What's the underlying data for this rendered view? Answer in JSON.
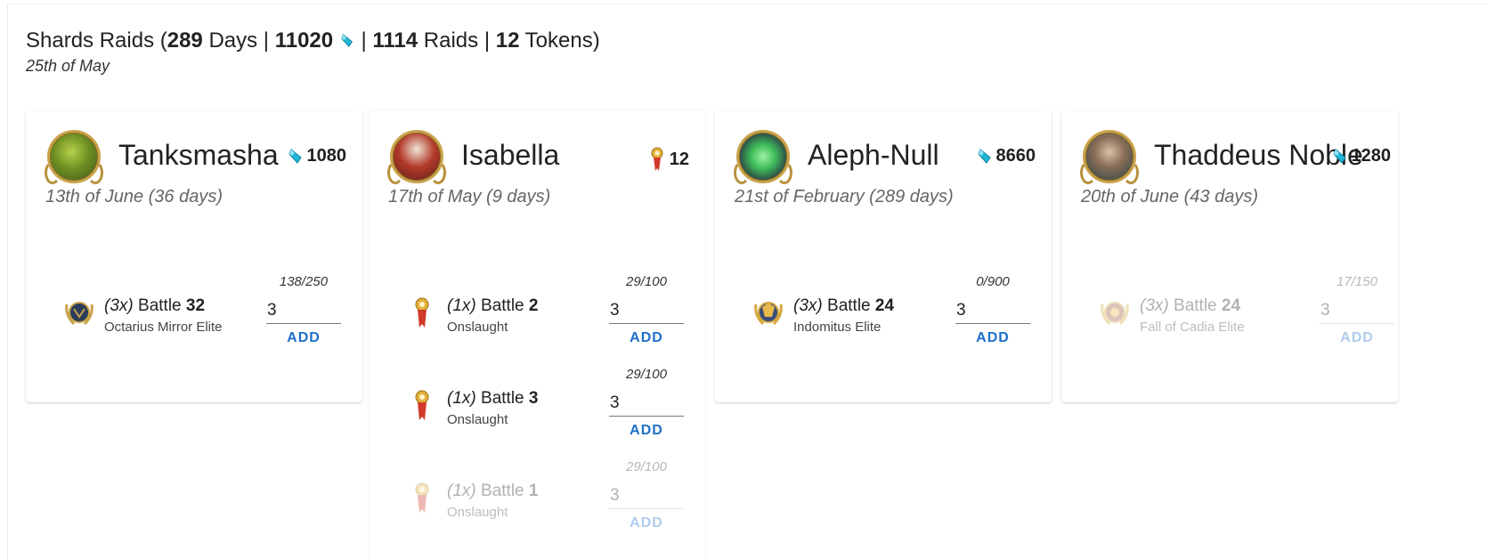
{
  "header": {
    "title_prefix": "Shards Raids (",
    "days_value": "289",
    "days_label": " Days | ",
    "shards_value": "11020",
    "sep1": " | ",
    "raids_value": "1114",
    "raids_label": " Raids | ",
    "tokens_value": "12",
    "tokens_label": " Tokens)",
    "date": "25th of May"
  },
  "colors": {
    "accent": "#1e6fc9",
    "shard": "#1fb7d6",
    "token": "#d13a2a"
  },
  "cards": [
    {
      "name": "Tanksmasha",
      "reward_icon": "shard-icon",
      "reward": "1080",
      "date": "13th of June (36 days)",
      "raids": [
        {
          "mult": "(3x)",
          "label": "Battle",
          "num": "32",
          "location": "Octarius Mirror Elite",
          "progress": "138/250",
          "qty": "3",
          "add": "ADD",
          "icon": "elite-laurel-icon"
        }
      ]
    },
    {
      "name": "Isabella",
      "reward_icon": "token-icon",
      "reward": "12",
      "date": "17th of May (9 days)",
      "raids": [
        {
          "mult": "(1x)",
          "label": "Battle",
          "num": "2",
          "location": "Onslaught",
          "progress": "29/100",
          "qty": "3",
          "add": "ADD",
          "icon": "onslaught-token-icon"
        },
        {
          "mult": "(1x)",
          "label": "Battle",
          "num": "3",
          "location": "Onslaught",
          "progress": "29/100",
          "qty": "3",
          "add": "ADD",
          "icon": "onslaught-token-icon"
        },
        {
          "mult": "(1x)",
          "label": "Battle",
          "num": "1",
          "location": "Onslaught",
          "progress": "29/100",
          "qty": "3",
          "add": "ADD",
          "icon": "onslaught-token-icon"
        }
      ]
    },
    {
      "name": "Aleph-Null",
      "reward_icon": "shard-icon",
      "reward": "8660",
      "date": "21st of February (289 days)",
      "raids": [
        {
          "mult": "(3x)",
          "label": "Battle",
          "num": "24",
          "location": "Indomitus Elite",
          "progress": "0/900",
          "qty": "3",
          "add": "ADD",
          "icon": "elite-laurel-icon"
        }
      ]
    },
    {
      "name": "Thaddeus Noble",
      "reward_icon": "shard-icon",
      "reward": "1280",
      "date": "20th of June (43 days)",
      "raids": [
        {
          "mult": "(3x)",
          "label": "Battle",
          "num": "24",
          "location": "Fall of Cadia Elite",
          "progress": "17/150",
          "qty": "3",
          "add": "ADD",
          "icon": "elite-laurel-icon"
        }
      ]
    }
  ]
}
